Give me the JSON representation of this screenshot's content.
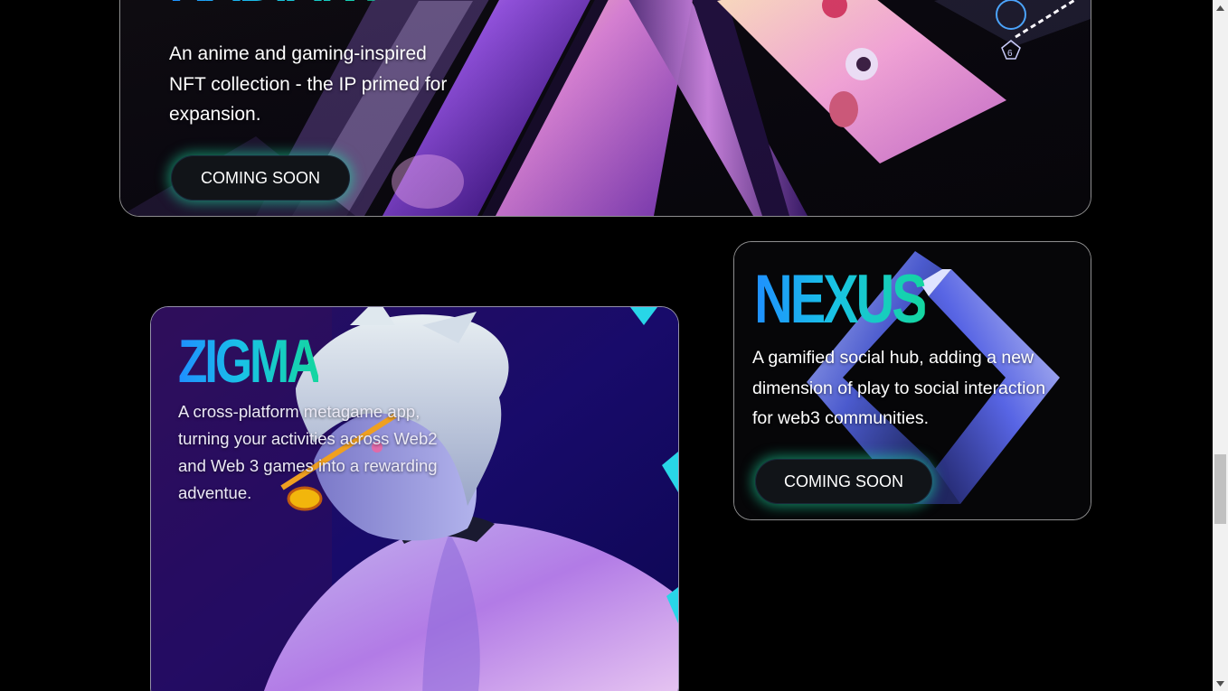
{
  "cards": {
    "radiant": {
      "title": "RADIANT",
      "description": "An anime and gaming-inspired NFT collection - the IP primed for expansion.",
      "button_label": "COMING SOON"
    },
    "zigma": {
      "title": "ZIGMA",
      "description": "A cross-platform metagame app, turning your activities across Web2 and Web 3 games into a rewarding adventue."
    },
    "nexus": {
      "title": "NEXUS",
      "description": "A gamified social hub, adding a new dimension of play to social interaction for web3 communities.",
      "button_label": "COMING SOON"
    }
  },
  "theme": {
    "title_gradient": [
      "#1f8fff",
      "#14d6a0"
    ],
    "button_bg": "#111418",
    "button_glow": "#1ee6aa",
    "page_bg": "#000000"
  },
  "scrollbar": {
    "up_icon": "triangle-up-icon",
    "down_icon": "triangle-down-icon"
  }
}
